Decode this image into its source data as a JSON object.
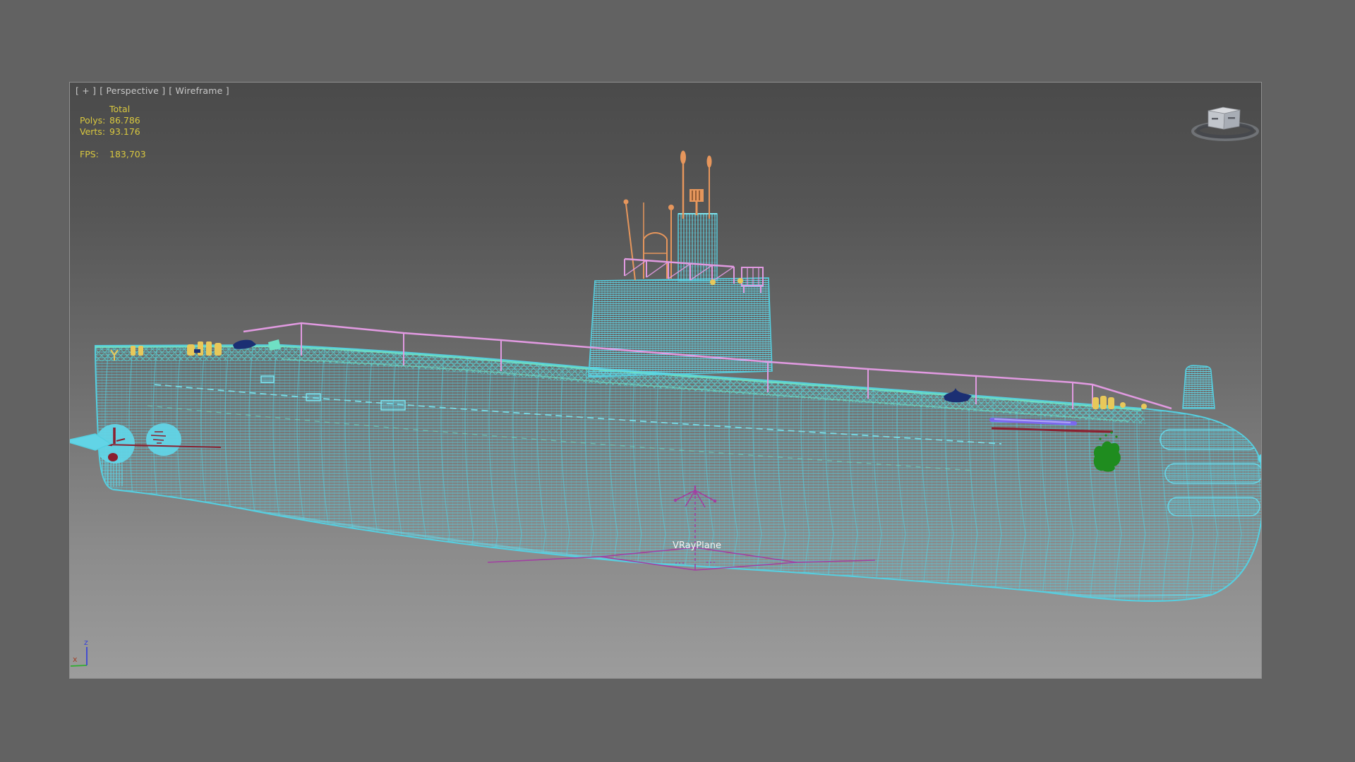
{
  "viewport": {
    "menus": {
      "pov": "[ + ]",
      "view": "[ Perspective ]",
      "shading": "[ Wireframe ]"
    },
    "statistics": {
      "total_header": "Total",
      "polys_label": "Polys:",
      "polys_value": "86.786",
      "verts_label": "Verts:",
      "verts_value": "93.176",
      "fps_label": "FPS:",
      "fps_value": "183,703"
    },
    "scene_object_label": "VRayPlane",
    "world_axis": {
      "z": "z",
      "x": "x"
    }
  },
  "colors": {
    "outer_background": "#626262",
    "viewport_gradient_top": "#4a4a4a",
    "viewport_gradient_bottom": "#9c9c9c",
    "wireframe_cyan": "#55cfe0",
    "deck_teal": "#6fe0c4",
    "antenna_orange": "#e6965c",
    "railing_pink": "#e19ae1",
    "gizmo_magenta": "#a23fa2",
    "stats_yellow": "#d9c83f",
    "viewport_label_gray": "#c8c8c8",
    "detail_navy": "#1b2f73",
    "detail_green": "#1f8c1f",
    "detail_red": "#8b1f2f",
    "detail_purple": "#7b68ee",
    "detail_yellow": "#e8c85a"
  }
}
